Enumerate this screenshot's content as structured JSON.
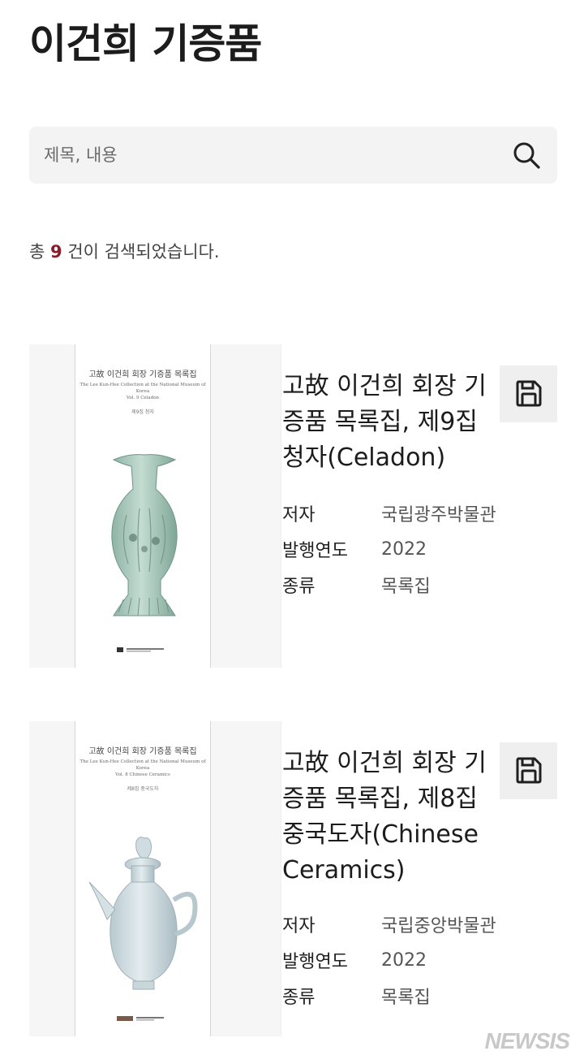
{
  "header": {
    "title": "이건희 기증품"
  },
  "search": {
    "placeholder": "제목, 내용"
  },
  "results": {
    "prefix": "총",
    "count": "9",
    "suffix": "건이 검색되었습니다."
  },
  "items": [
    {
      "title": "고故 이건희 회장 기증품 목록집, 제9집 청자(Celadon)",
      "cover_title": "고故 이건희 회장 기증품 목록집",
      "cover_subtitle": "The Lee Kun-Hee Collection at the National Museum of Korea",
      "cover_volume": "Vol. 9 Celadon",
      "cover_volume_kr": "제9집 청자",
      "meta": [
        {
          "label": "저자",
          "value": "국립광주박물관"
        },
        {
          "label": "발행연도",
          "value": "2022"
        },
        {
          "label": "종류",
          "value": "목록집"
        }
      ]
    },
    {
      "title": "고故 이건희 회장 기증품 목록집, 제8집 중국도자(Chinese Ceramics)",
      "cover_title": "고故 이건희 회장 기증품 목록집",
      "cover_subtitle": "The Lee Kun-Hee Collection at the National Museum of Korea",
      "cover_volume": "Vol. 8 Chinese Ceramics",
      "cover_volume_kr": "제8집 중국도자",
      "meta": [
        {
          "label": "저자",
          "value": "국립중앙박물관"
        },
        {
          "label": "발행연도",
          "value": "2022"
        },
        {
          "label": "종류",
          "value": "목록집"
        }
      ]
    }
  ],
  "icons": {
    "search": "search-icon",
    "save": "save-icon"
  },
  "colors": {
    "accent": "#8a1c2b",
    "search_bg": "#f3f3f3",
    "button_bg": "#efefef"
  },
  "watermark": "NEWSIS"
}
